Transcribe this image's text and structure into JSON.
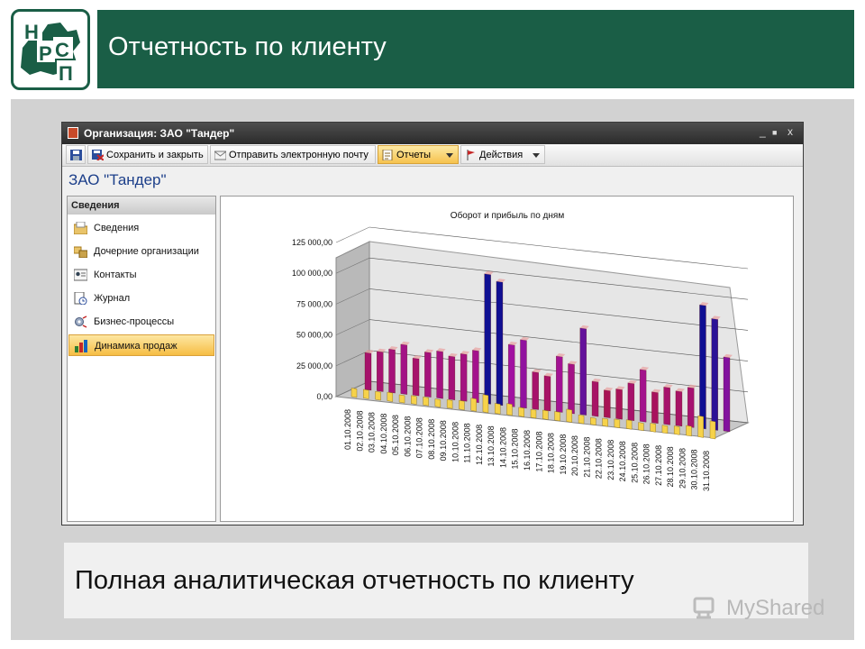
{
  "slide": {
    "title": "Отчетность по клиенту",
    "caption": "Полная аналитическая отчетность по клиенту",
    "watermark": "MyShared",
    "logo_letters": [
      "Н",
      "С",
      "Р",
      "П"
    ],
    "brand_color": "#1a5e46"
  },
  "window": {
    "title": "Организация: ЗАО \"Тандер\"",
    "controls": [
      "_",
      "■",
      "x"
    ],
    "toolbar": [
      {
        "label": "",
        "icon": "save-icon"
      },
      {
        "label": "Сохранить и закрыть",
        "icon": "save-close-icon"
      },
      {
        "label": "Отправить электронную почту",
        "icon": "email-icon"
      },
      {
        "label": "Отчеты",
        "icon": "report-icon",
        "dropdown": true,
        "active": true
      },
      {
        "label": "Действия",
        "icon": "flag-icon",
        "dropdown": true
      }
    ],
    "org_name": "ЗАО \"Тандер\""
  },
  "sidebar": {
    "header": "Сведения",
    "items": [
      {
        "label": "Сведения",
        "icon": "folder-icon"
      },
      {
        "label": "Дочерние организации",
        "icon": "branches-icon"
      },
      {
        "label": "Контакты",
        "icon": "contact-card-icon"
      },
      {
        "label": "Журнал",
        "icon": "journal-icon"
      },
      {
        "label": "Бизнес-процессы",
        "icon": "gear-process-icon"
      },
      {
        "label": "Динамика продаж",
        "icon": "bar-chart-icon",
        "active": true
      }
    ]
  },
  "chart_data": {
    "type": "bar",
    "title": "Оборот и прибыль по дням",
    "ytick_labels": [
      "0,00",
      "25 000,00",
      "50 000,00",
      "75 000,00",
      "100 000,00",
      "125 000,00"
    ],
    "ylim": [
      0,
      125000
    ],
    "categories": [
      "01.10.2008",
      "02.10.2008",
      "03.10.2008",
      "04.10.2008",
      "05.10.2008",
      "06.10.2008",
      "07.10.2008",
      "08.10.2008",
      "09.10.2008",
      "10.10.2008",
      "11.10.2008",
      "12.10.2008",
      "13.10.2008",
      "14.10.2008",
      "15.10.2008",
      "16.10.2008",
      "17.10.2008",
      "18.10.2008",
      "19.10.2008",
      "20.10.2008",
      "21.10.2008",
      "22.10.2008",
      "23.10.2008",
      "24.10.2008",
      "25.10.2008",
      "26.10.2008",
      "27.10.2008",
      "28.10.2008",
      "29.10.2008",
      "30.10.2008",
      "31.10.2008"
    ],
    "series": [
      {
        "values": [
          30000,
          32000,
          35000,
          40000,
          30000,
          36000,
          38000,
          35000,
          38000,
          42000,
          105000,
          100000,
          50000,
          55000,
          30000,
          28000,
          45000,
          40000,
          70000,
          28000,
          22000,
          24000,
          30000,
          42000,
          25000,
          30000,
          28000,
          32000,
          100000,
          90000,
          60000
        ]
      },
      {
        "values": [
          7000,
          7000,
          6500,
          7000,
          6000,
          6500,
          6500,
          6000,
          6500,
          7000,
          10000,
          14000,
          8000,
          9000,
          7000,
          6500,
          7000,
          7000,
          10000,
          6500,
          5500,
          6000,
          6500,
          7000,
          6000,
          6500,
          6000,
          6500,
          8000,
          17000,
          14000
        ]
      }
    ],
    "grid": true
  }
}
